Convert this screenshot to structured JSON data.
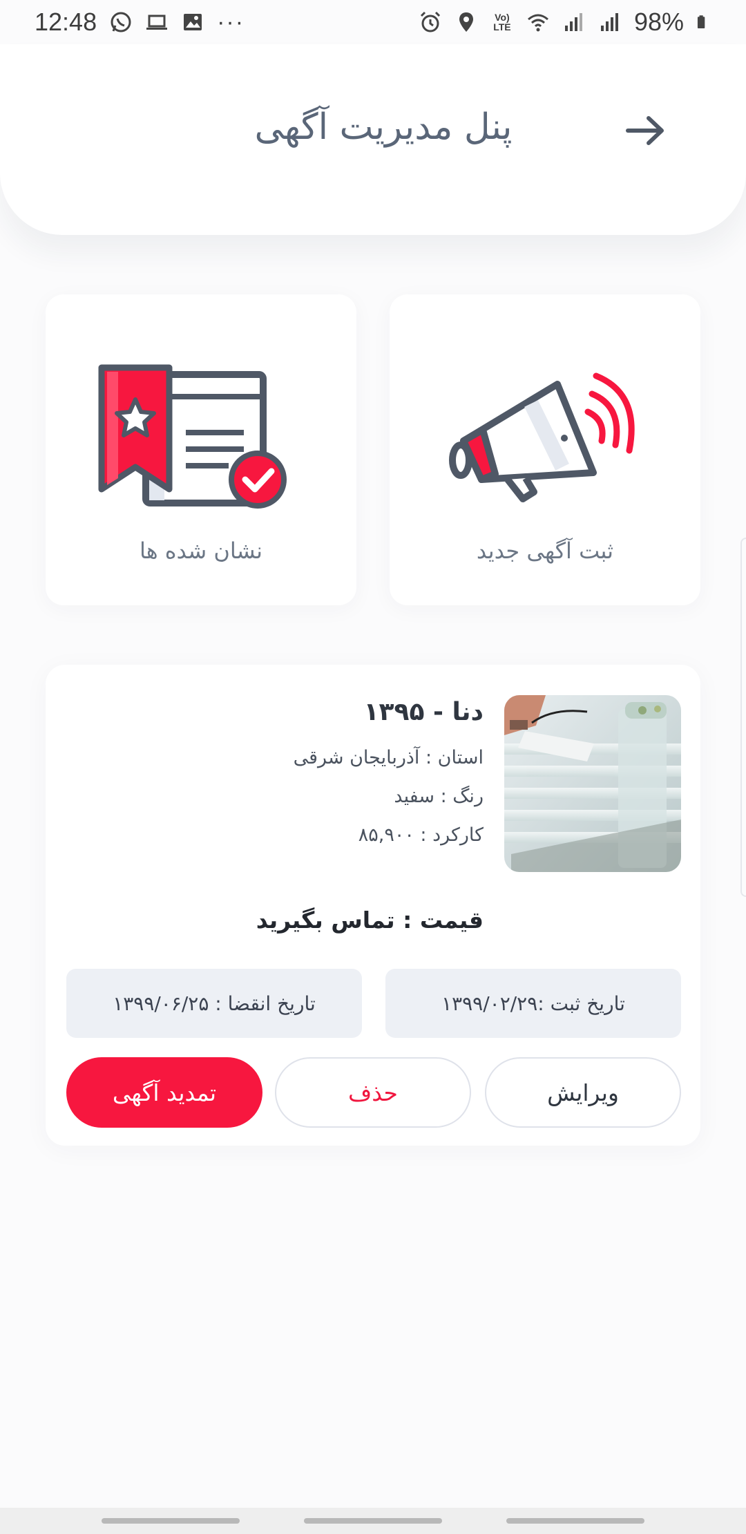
{
  "status_bar": {
    "time": "12:48",
    "battery": "98%",
    "more": "···",
    "volte": "Vo) LTE"
  },
  "header": {
    "title": "پنل مدیریت آگهی"
  },
  "actions": {
    "new_ad": "ثبت آگهی جدید",
    "bookmarks": "نشان شده ها"
  },
  "ad": {
    "title": "دنا - ۱۳۹۵",
    "province": "استان : آذربایجان شرقی",
    "color": "رنگ : سفید",
    "mileage": "کارکرد : ۸۵,۹۰۰",
    "price": "قیمت : تماس بگیرید",
    "registered_date": "تاریخ ثبت :۱۳۹۹/۰۲/۲۹",
    "expiry_date": "تاریخ انقضا : ۱۳۹۹/۰۶/۲۵",
    "buttons": {
      "edit": "ویرایش",
      "delete": "حذف",
      "renew": "تمدید آگهی"
    }
  },
  "colors": {
    "accent": "#f7173f",
    "icon_dark": "#4f5866",
    "text_muted": "#6b7685"
  }
}
